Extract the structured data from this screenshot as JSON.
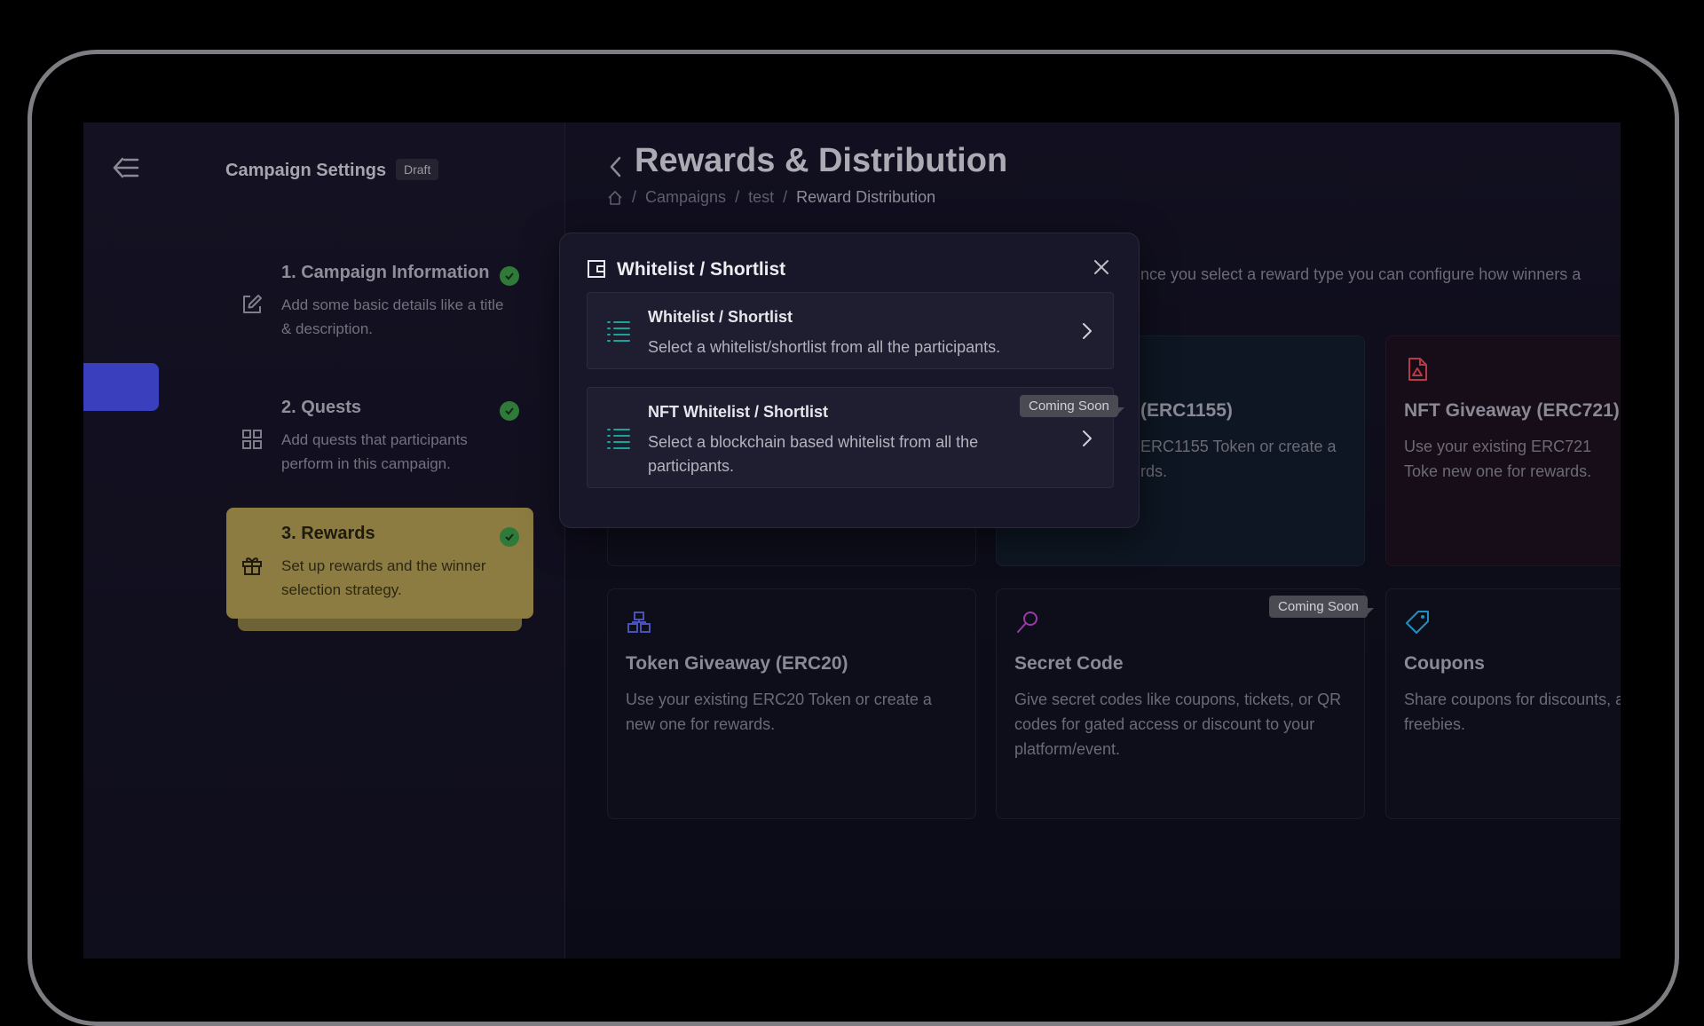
{
  "sidebar": {
    "title": "Campaign Settings",
    "status_badge": "Draft",
    "steps": [
      {
        "title": "1. Campaign Information",
        "description": "Add some basic details like a title & description.",
        "icon": "edit-icon",
        "complete": true
      },
      {
        "title": "2. Quests",
        "description": "Add quests that participants perform in this campaign.",
        "icon": "grid-icon",
        "complete": true
      },
      {
        "title": "3. Rewards",
        "description": "Set up rewards and the winner selection strategy.",
        "icon": "gift-icon",
        "complete": true,
        "active": true
      }
    ]
  },
  "header": {
    "title": "Rewards & Distribution",
    "breadcrumb": [
      "Campaigns",
      "test",
      "Reward Distribution"
    ]
  },
  "main": {
    "intro": "gn. Once you select a reward type you can configure how winners a",
    "cards": [
      {
        "title": "(ERC1155)",
        "description": "ERC1155 Token or create a rds.",
        "icon": "none"
      },
      {
        "title": "NFT Giveaway (ERC721)",
        "description": "Use your existing ERC721 Toke new one for rewards.",
        "icon": "file-icon"
      },
      {
        "title": "Token Giveaway (ERC20)",
        "description": "Use your existing ERC20 Token or create a new one for rewards.",
        "icon": "blocks-icon"
      },
      {
        "title": "Secret Code",
        "description": "Give secret codes like coupons, tickets, or QR codes for gated access or discount to your platform/event.",
        "icon": "key-icon",
        "badge": "Coming Soon"
      },
      {
        "title": "Coupons",
        "description": "Share coupons for discounts, a freebies.",
        "icon": "tag-icon"
      }
    ]
  },
  "modal": {
    "title": "Whitelist / Shortlist",
    "options": [
      {
        "title": "Whitelist / Shortlist",
        "description": "Select a whitelist/shortlist from all the participants."
      },
      {
        "title": "NFT Whitelist / Shortlist",
        "description": "Select a blockchain based whitelist from all the participants.",
        "badge": "Coming Soon"
      }
    ]
  },
  "colors": {
    "accent": "#3a3fbd",
    "active_step": "#8c7c41",
    "check": "#2f7a39",
    "teal_icon": "#1aa39a"
  }
}
